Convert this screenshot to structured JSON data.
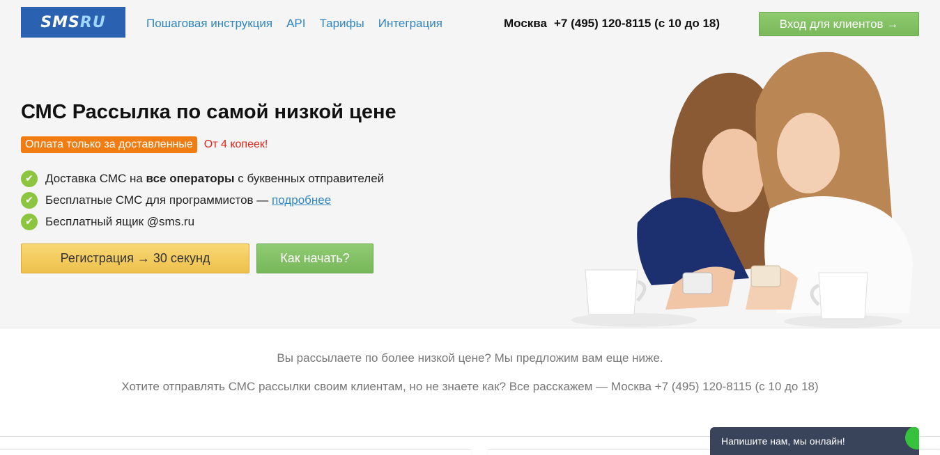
{
  "header": {
    "logo_main": "SMS",
    "logo_accent": "RU",
    "nav": [
      "Пошаговая инструкция",
      "API",
      "Тарифы",
      "Интеграция"
    ],
    "city": "Москва",
    "phone": "+7 (495) 120-8115 (с 10 до 18)",
    "login_button": "Вход для клиентов →"
  },
  "hero": {
    "headline": "СМС Рассылка по самой низкой цене",
    "badge": "Оплата только за доставленные",
    "price_note": "От 4 копеек!",
    "features": {
      "f1_before": "Доставка СМС на ",
      "f1_bold": "все операторы",
      "f1_after": " с буквенных отправителей",
      "f2_text": "Бесплатные СМС для программистов — ",
      "f2_link": "подробнее",
      "f3_text": "Бесплатный ящик @sms.ru"
    },
    "register_button": "Регистрация → 30 секунд",
    "start_button": "Как начать?"
  },
  "info": {
    "line1": "Вы рассылаете по более низкой цене? Мы предложим вам еще ниже.",
    "line2": "Хотите отправлять СМС рассылки своим клиентам, но не знаете как? Все расскажем — Москва  +7 (495) 120-8115 (с 10 до 18)"
  },
  "chat": {
    "label": "Напишите нам, мы онлайн!"
  },
  "icons": {
    "check": "check-icon"
  },
  "colors": {
    "brand_blue": "#2a61b0",
    "link_blue": "#2f85c2",
    "accent_green": "#8cc640",
    "badge_orange": "#f07c12",
    "price_red": "#e1251b",
    "register_yellow": "#f3cb5d",
    "chat_dark": "#39435a"
  }
}
